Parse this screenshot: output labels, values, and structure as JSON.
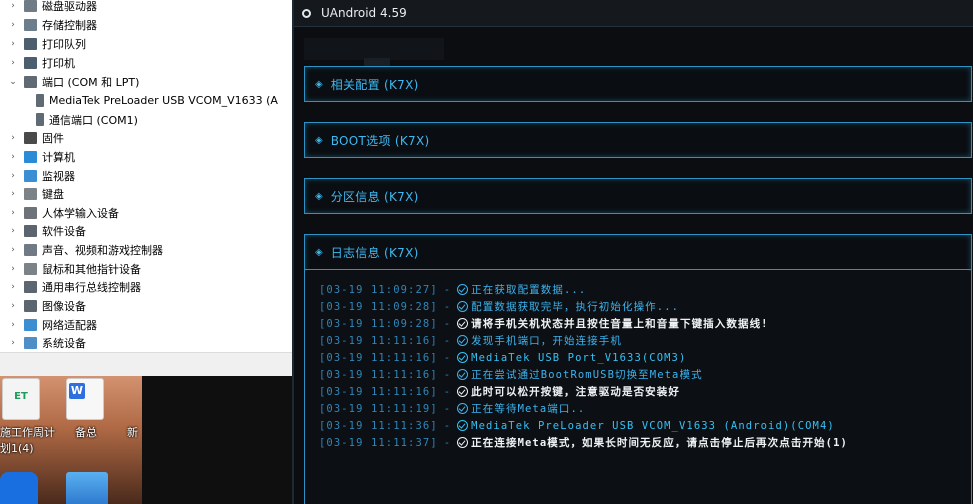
{
  "device_manager": {
    "items": [
      {
        "label": "磁盘驱动器",
        "arrow": ">",
        "icon": "disk-drive-icon",
        "color": "#6f7b85"
      },
      {
        "label": "存储控制器",
        "arrow": ">",
        "icon": "storage-controller-icon",
        "color": "#6c7d8c"
      },
      {
        "label": "打印队列",
        "arrow": ">",
        "icon": "print-queue-icon",
        "color": "#4d5e6e"
      },
      {
        "label": "打印机",
        "arrow": ">",
        "icon": "printer-icon",
        "color": "#4d5e6e"
      },
      {
        "label": "端口 (COM 和 LPT)",
        "arrow": "v",
        "icon": "port-icon",
        "color": "#5f6a74"
      },
      {
        "label": "MediaTek PreLoader USB VCOM_V1633 (A",
        "arrow": "",
        "icon": "port-device-icon",
        "color": "#5f6a74",
        "child": true
      },
      {
        "label": "通信端口 (COM1)",
        "arrow": "",
        "icon": "port-device-icon",
        "color": "#5f6a74",
        "child": true
      },
      {
        "label": "固件",
        "arrow": ">",
        "icon": "firmware-icon",
        "color": "#4a4a4a"
      },
      {
        "label": "计算机",
        "arrow": ">",
        "icon": "computer-icon",
        "color": "#2a8bd6"
      },
      {
        "label": "监视器",
        "arrow": ">",
        "icon": "monitor-icon",
        "color": "#3a8fd4"
      },
      {
        "label": "键盘",
        "arrow": ">",
        "icon": "keyboard-icon",
        "color": "#7b8288"
      },
      {
        "label": "人体学输入设备",
        "arrow": ">",
        "icon": "hid-icon",
        "color": "#6d7379"
      },
      {
        "label": "软件设备",
        "arrow": ">",
        "icon": "software-device-icon",
        "color": "#5a6570"
      },
      {
        "label": "声音、视频和游戏控制器",
        "arrow": ">",
        "icon": "sound-icon",
        "color": "#6f7a84"
      },
      {
        "label": "鼠标和其他指针设备",
        "arrow": ">",
        "icon": "mouse-icon",
        "color": "#7b8288"
      },
      {
        "label": "通用串行总线控制器",
        "arrow": ">",
        "icon": "usb-icon",
        "color": "#5b6670"
      },
      {
        "label": "图像设备",
        "arrow": ">",
        "icon": "camera-icon",
        "color": "#5b6670"
      },
      {
        "label": "网络适配器",
        "arrow": ">",
        "icon": "network-adapter-icon",
        "color": "#3b8ed0"
      },
      {
        "label": "系统设备",
        "arrow": ">",
        "icon": "system-device-icon",
        "color": "#4f8fc8"
      }
    ]
  },
  "desktop": {
    "icons": [
      {
        "name": "et-file-icon",
        "badge": "ET",
        "label": "施工作周计"
      },
      {
        "name": "wps-writer-icon",
        "badge": "W",
        "label": "备总"
      },
      {
        "name": "new-item-icon",
        "badge": "",
        "label": "新"
      }
    ],
    "second_line": "划1(4)"
  },
  "uandroid": {
    "title": "UAndroid 4.59",
    "panels": [
      {
        "title": "相关配置 (K7X)"
      },
      {
        "title": "BOOT选项 (K7X)"
      },
      {
        "title": "分区信息 (K7X)"
      }
    ],
    "log_panel": {
      "title": "日志信息 (K7X)"
    },
    "log": [
      {
        "ts": "[03-19 11:09:27]",
        "msg": "正在获取配置数据...",
        "tone": "blue"
      },
      {
        "ts": "[03-19 11:09:28]",
        "msg": "配置数据获取完毕，执行初始化操作...",
        "tone": "blue"
      },
      {
        "ts": "[03-19 11:09:28]",
        "msg": "请将手机关机状态并且按住音量上和音量下键插入数据线!",
        "tone": "white"
      },
      {
        "ts": "[03-19 11:11:16]",
        "msg": "发现手机端口，开始连接手机",
        "tone": "blue"
      },
      {
        "ts": "[03-19 11:11:16]",
        "msg": "MediaTek USB Port_V1633(COM3)",
        "tone": "cyan"
      },
      {
        "ts": "[03-19 11:11:16]",
        "msg": "正在尝试通过BootRomUSB切换至Meta模式",
        "tone": "blue"
      },
      {
        "ts": "[03-19 11:11:16]",
        "msg": "此时可以松开按键，注意驱动是否安装好",
        "tone": "white"
      },
      {
        "ts": "[03-19 11:11:19]",
        "msg": "正在等待Meta端口..",
        "tone": "blue"
      },
      {
        "ts": "[03-19 11:11:36]",
        "msg": "MediaTek PreLoader USB VCOM_V1633 (Android)(COM4)",
        "tone": "cyan"
      },
      {
        "ts": "[03-19 11:11:37]",
        "msg": "正在连接Meta模式，如果长时间无反应，请点击停止后再次点击开始(1)",
        "tone": "white"
      }
    ],
    "separator": "-"
  }
}
